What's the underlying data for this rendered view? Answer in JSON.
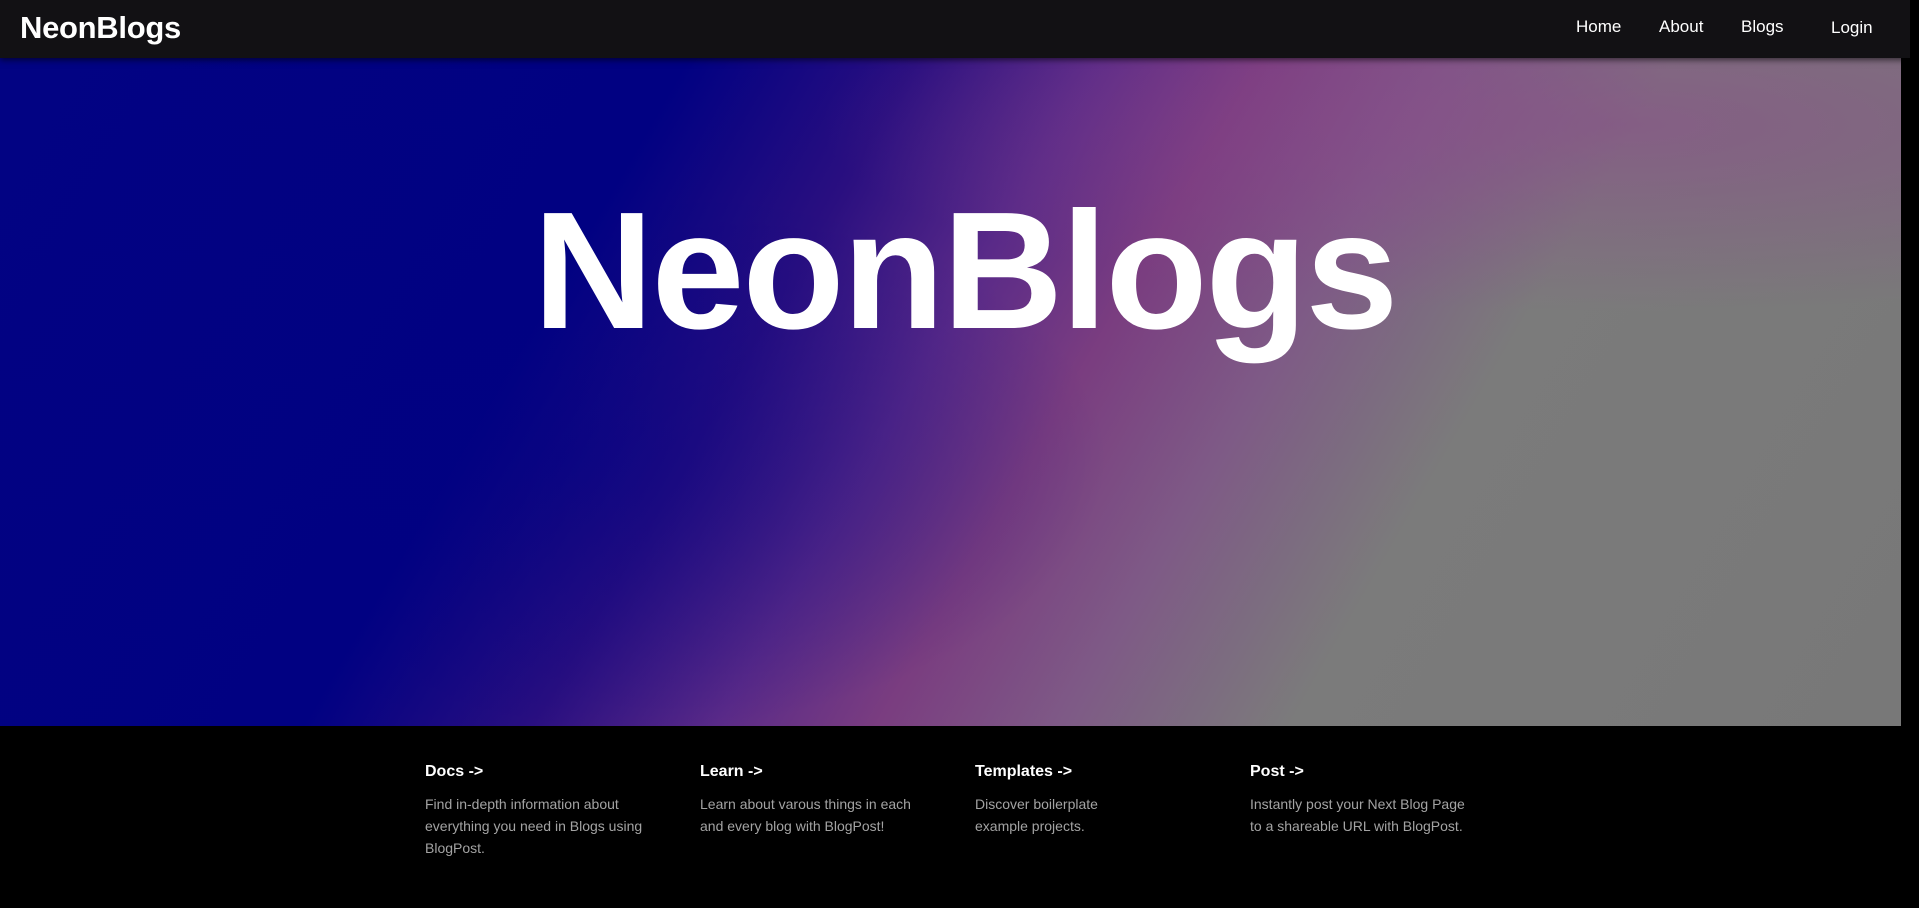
{
  "nav": {
    "brand": "NeonBlogs",
    "links": [
      "Home",
      "About",
      "Blogs"
    ],
    "login": "Login"
  },
  "hero": {
    "title": "NeonBlogs"
  },
  "cards": [
    {
      "title": "Docs ->",
      "description": "Find in-depth information about everything you need in Blogs using BlogPost."
    },
    {
      "title": "Learn ->",
      "description": "Learn about varous things in each and every blog with BlogPost!"
    },
    {
      "title": "Templates ->",
      "description": "Discover boilerplate example projects."
    },
    {
      "title": "Post ->",
      "description": "Instantly post your Next Blog Page to a shareable URL with BlogPost."
    }
  ],
  "colors": {
    "navbar_bg": "#121114",
    "hero_start": "#020383",
    "hero_mid": "#7a3d80",
    "hero_end": "#787878",
    "card_text": "#a3a3a3"
  }
}
